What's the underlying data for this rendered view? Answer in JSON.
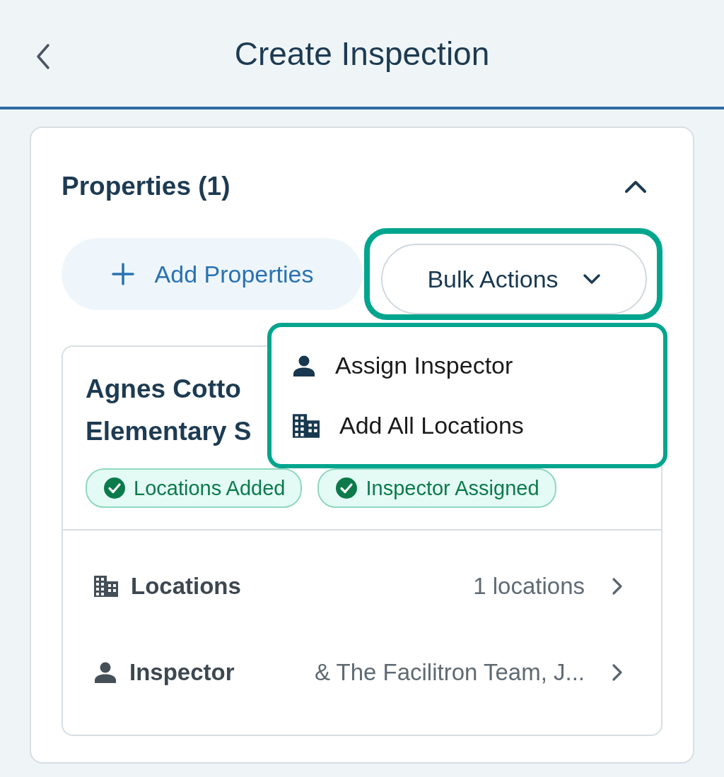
{
  "header": {
    "title": "Create Inspection"
  },
  "section": {
    "title": "Properties (1)",
    "expanded": true
  },
  "actions": [
    {
      "label": "Add Properties",
      "kind": "add"
    },
    {
      "label": "Bulk Actions",
      "kind": "dropdown",
      "highlighted": true
    }
  ],
  "menu": {
    "highlighted": true,
    "items": [
      {
        "label": "Assign Inspector",
        "kind": "person"
      },
      {
        "label": "Add All Locations",
        "kind": "building"
      }
    ]
  },
  "property": {
    "title_lines": [
      "Agnes Cotto",
      "Elementary S"
    ],
    "tags": [
      {
        "label": "Locations Added"
      },
      {
        "label": "Inspector Assigned"
      }
    ],
    "rows": [
      {
        "kind": "building",
        "label": "Locations",
        "value": "1 locations"
      },
      {
        "kind": "person",
        "label": "Inspector",
        "value": "& The Facilitron Team, J..."
      }
    ]
  }
}
